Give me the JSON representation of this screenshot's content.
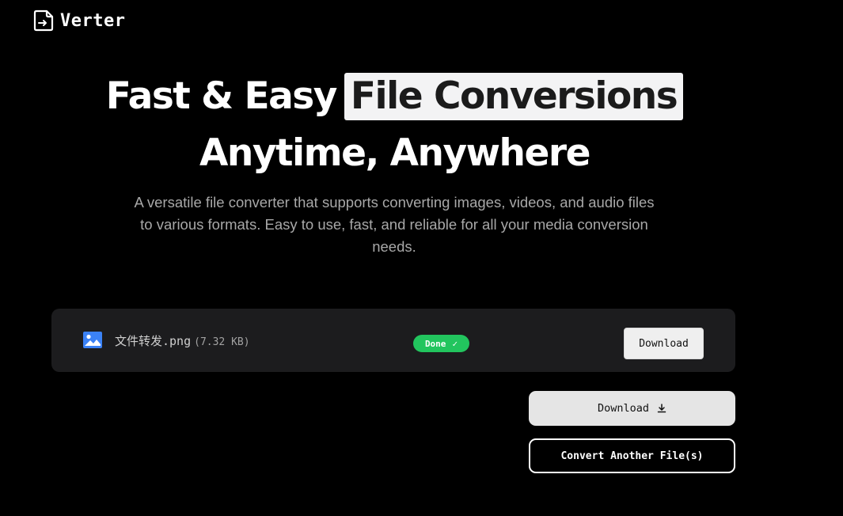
{
  "brand": {
    "name": "Verter",
    "icon": "file-convert-icon"
  },
  "hero": {
    "title_part1": "Fast & Easy",
    "title_highlight": "File Conversions",
    "title_line2": "Anytime, Anywhere",
    "subtitle": "A versatile file converter that supports converting images, videos, and audio files to various formats. Easy to use, fast, and reliable for all your media conversion needs."
  },
  "files": [
    {
      "icon": "image-icon",
      "name": "文件转发.png",
      "size": "(7.32 KB)",
      "status": "Done",
      "status_icon": "check-icon",
      "download_label": "Download"
    }
  ],
  "actions": {
    "download_all_label": "Download",
    "download_icon": "download-icon",
    "convert_another_label": "Convert Another File(s)"
  },
  "colors": {
    "background": "#000000",
    "card": "#1c1c1e",
    "done_badge": "#22c55e",
    "highlight_bg": "#f3f3f4",
    "file_icon": "#3b82f6"
  }
}
